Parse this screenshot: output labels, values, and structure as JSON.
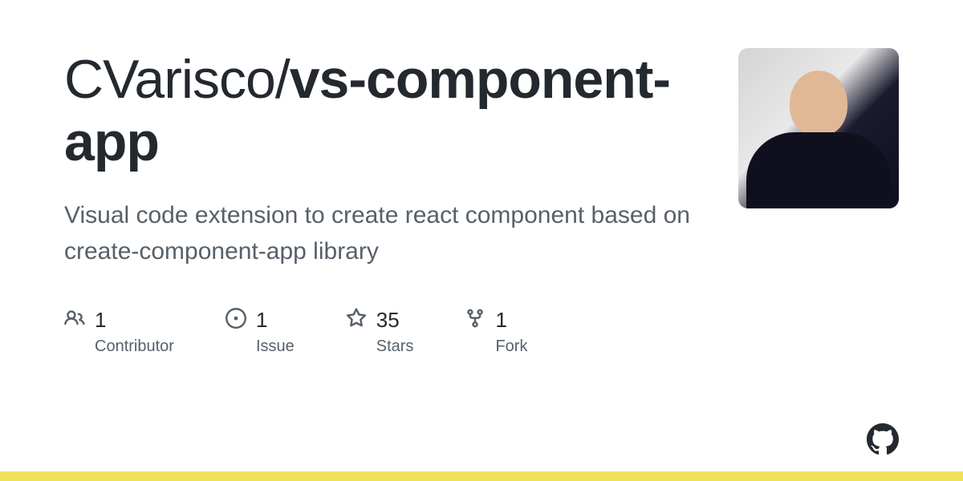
{
  "repo": {
    "owner": "CVarisco",
    "slash": "/",
    "name": "vs-component-app"
  },
  "description": "Visual code extension to create react component based on create-component-app library",
  "stats": {
    "contributors": {
      "value": "1",
      "label": "Contributor"
    },
    "issues": {
      "value": "1",
      "label": "Issue"
    },
    "stars": {
      "value": "35",
      "label": "Stars"
    },
    "forks": {
      "value": "1",
      "label": "Fork"
    }
  },
  "languages": [
    {
      "color": "#f1e05a",
      "percent": 100
    }
  ]
}
